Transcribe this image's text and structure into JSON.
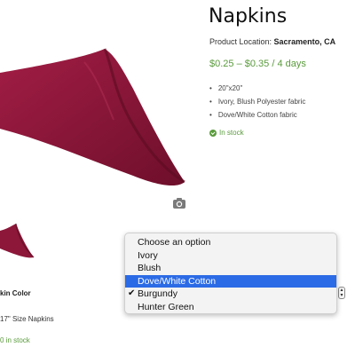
{
  "product": {
    "title": "Napkins",
    "location_label": "Product Location: ",
    "location_value": "Sacramento, CA",
    "price": "$0.25 – $0.35 / 4 days",
    "features": [
      "20\"x20\"",
      "Ivory, Blush Polyester fabric",
      "Dove/White Cotton fabric"
    ],
    "stock": "In stock",
    "image_color": "#8c1739"
  },
  "variant": {
    "color_label": "kin Color",
    "size_label": "17\" Size Napkins",
    "stock": "0 in stock"
  },
  "dropdown": {
    "options": [
      "Choose an option",
      "Ivory",
      "Blush",
      "Dove/White Cotton",
      "Burgundy",
      "Hunter Green"
    ],
    "highlighted": "Dove/White Cotton",
    "selected": "Burgundy",
    "highlight_color": "#2c6be6"
  }
}
